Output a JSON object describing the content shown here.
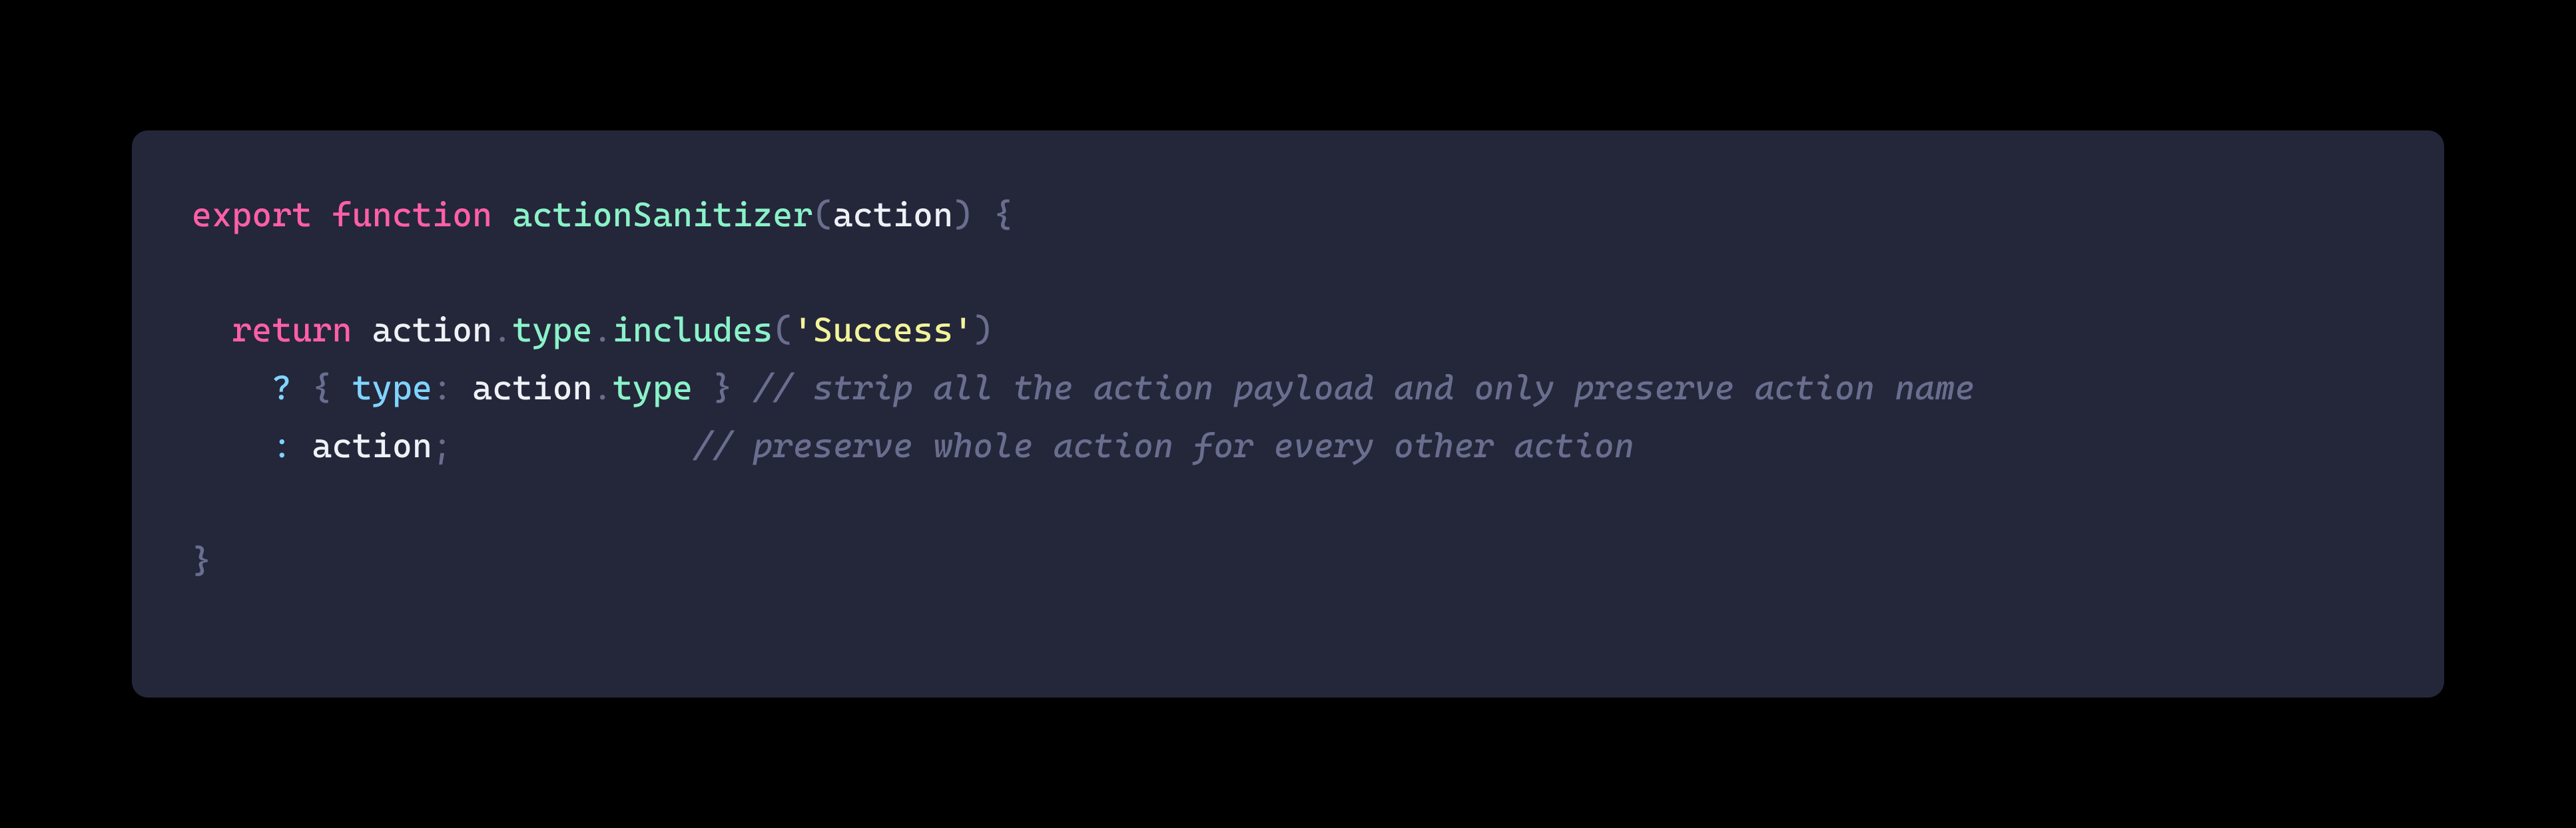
{
  "colors": {
    "background": "#000000",
    "panel": "#24263a",
    "keyword": "#ff5fa6",
    "function_name": "#8af2c8",
    "member": "#8af2c8",
    "punctuation": "#6a6e8e",
    "operator_ternary": "#7fd4ff",
    "key": "#7fd4ff",
    "string": "#f3f49a",
    "identifier": "#eef1f6",
    "comment": "#6a6e8e"
  },
  "code": {
    "line1": {
      "export": "export",
      "function": "function",
      "fn_name": "actionSanitizer",
      "lparen": "(",
      "param": "action",
      "rparen": ")",
      "lbrace": "{"
    },
    "line2_blank": "",
    "line3": {
      "indent": "  ",
      "return": "return",
      "ident1": "action",
      "dot1": ".",
      "member1": "type",
      "dot2": ".",
      "method": "includes",
      "lparen": "(",
      "string": "'Success'",
      "rparen": ")"
    },
    "line4": {
      "indent": "    ",
      "ternary_q": "?",
      "lbrace": "{",
      "key": "type",
      "colon": ":",
      "ident": "action",
      "dot": ".",
      "member": "type",
      "rbrace": "}",
      "comment": "// strip all the action payload and only preserve action name"
    },
    "line5": {
      "indent": "    ",
      "ternary_c": ":",
      "ident": "action",
      "semi": ";",
      "pad": "            ",
      "comment": "// preserve whole action for every other action"
    },
    "line6_blank": "",
    "line7": {
      "rbrace": "}"
    }
  }
}
